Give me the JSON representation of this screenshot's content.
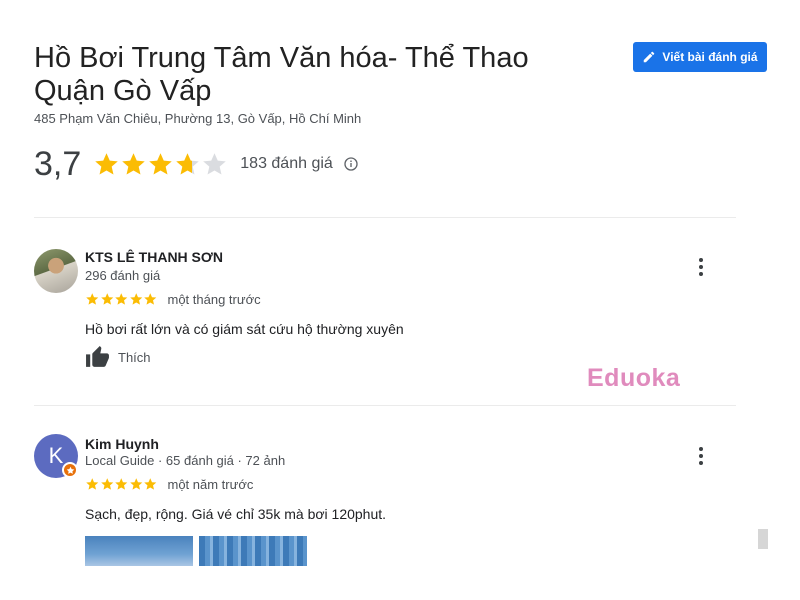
{
  "place": {
    "title": "Hồ Bơi Trung Tâm Văn hóa- Thể Thao Quận Gò Vấp",
    "address": "485 Phạm Văn Chiêu, Phường 13, Gò Vấp, Hồ Chí Minh",
    "rating": "3,7",
    "rating_stars": 3.7,
    "review_count": "183 đánh giá"
  },
  "write_review": {
    "label": "Viết bài đánh giá",
    "icon": "pencil-icon"
  },
  "colors": {
    "accent": "#1a73e8",
    "star": "#fbbc04",
    "star_empty": "#dadce0",
    "watermark": "#e08bbd",
    "local_guide_badge": "#e8710a"
  },
  "reviews": [
    {
      "name": "KTS LÊ THANH SƠN",
      "meta": "296 đánh giá",
      "stars": 5,
      "time": "một tháng trước",
      "text": "Hồ bơi rất lớn và có giám sát cứu hộ thường xuyên",
      "like_label": "Thích"
    },
    {
      "name": "Kim Huynh",
      "avatar_letter": "K",
      "meta": "Local Guide · 65 đánh giá · 72 ảnh",
      "stars": 5,
      "time": "một năm trước",
      "text": "Sạch, đẹp, rộng. Giá vé chỉ 35k mà bơi 120phut."
    }
  ],
  "watermark": "Eduoka"
}
